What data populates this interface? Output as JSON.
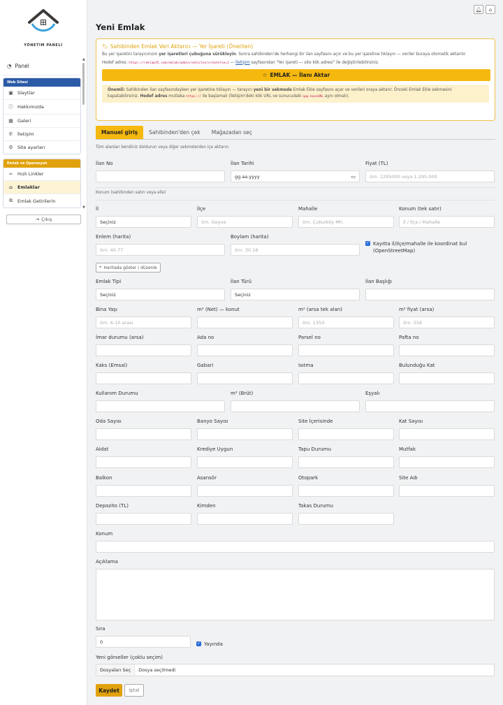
{
  "sidebar": {
    "brand": "YÖNETİM PANELİ",
    "panel": "Panel",
    "group1_title": "Web Sitesi",
    "group1_items": [
      "Slaytlar",
      "Hakkımızda",
      "Galeri",
      "İletişim",
      "Site ayarları"
    ],
    "group2_title": "Emlak ve Operasyon",
    "group2_items": [
      "Hızlı Linkler",
      "Emlaklar",
      "Emlak Getirilerin"
    ],
    "logout": "Çıkış"
  },
  "page_title": "Yeni Emlak",
  "importer": {
    "title": "Sahibinden Emlak Veri Aktarıcı — Yer İşareti (Önerilen)",
    "p1_a": "Bu yer işaretini tarayıcınızın ",
    "p1_b": "yer işaretleri çubuğuna sürükleyin",
    "p1_c": ". Sonra sahibinden'de herhangi bir ilan sayfasını açın ve bu yer işaretine tıklayın — veriler buraya otomatik aktarılır.",
    "p2_a": "Hedef adres: ",
    "p2_url": "https://reklam35.com/emlak/admin/vehicles/create?se=1",
    "p2_b": " — ",
    "p2_link": "İletişim",
    "p2_c": " sayfasından \"Yer işareti — site kök adresi\" ile değiştirilebilirsiniz.",
    "button": "EMLAK — İlanı Aktar",
    "note_a": "Önemli:",
    "note_b": " Sahibinden ilan sayfasındayken yer işaretine tıklayın — tarayıcı ",
    "note_c": "yeni bir sekmede",
    "note_d": " Emlak Ekle sayfasını açar ve verileri oraya aktarır. Önceki Emlak Ekle sekmesini kapatabilirsiniz. ",
    "note_e": "Hedef adres",
    "note_f": " mutlaka ",
    "note_code1": "https://",
    "note_g": " ile başlamalı (İletişim'deki kök URL ve sunucudaki ",
    "note_code2": "app.baseURL",
    "note_h": " aynı olmalı)."
  },
  "tabs": [
    "Manuel giriş",
    "Sahibinden'den çek",
    "Mağazadan seç"
  ],
  "tab_hint": "Tüm alanları kendiniz doldurun veya diğer sekmelerden içe aktarın.",
  "section_hint": "Konum (sahibinden satırı veya elle)",
  "fields": {
    "ilan_no": {
      "label": "İlan No",
      "value": ""
    },
    "ilan_tarihi": {
      "label": "İlan Tarihi",
      "value": "gg.aa.yyyy"
    },
    "fiyat": {
      "label": "Fiyat (TL)",
      "placeholder": "örn. 1295000 veya 1.295.000"
    },
    "il": {
      "label": "İl",
      "value": "Seçiniz"
    },
    "ilce": {
      "label": "İlçe",
      "placeholder": "örn. Geyve"
    },
    "mahalle": {
      "label": "Mahalle",
      "placeholder": "örn. Çukurköy Mh."
    },
    "konum_tek": {
      "label": "Konum (tek satır)",
      "placeholder": "İl / İlçe / Mahalle"
    },
    "enlem": {
      "label": "Enlem (harita)",
      "placeholder": "örn. 40.77"
    },
    "boylam": {
      "label": "Boylam (harita)",
      "placeholder": "örn. 30.18"
    },
    "emlak_tipi": {
      "label": "Emlak Tipi",
      "value": "Seçiniz"
    },
    "ilan_turu": {
      "label": "İlan Türü",
      "value": "Seçiniz"
    },
    "ilan_basligi": {
      "label": "İlan Başlığı",
      "value": ""
    },
    "bina_yasi": {
      "label": "Bina Yaşı",
      "placeholder": "örn. 6-10 arası"
    },
    "m2_net": {
      "label": "m² (Net) — konut",
      "value": ""
    },
    "m2_arsa": {
      "label": "m² (arsa tek alan)",
      "placeholder": "örn. 1350"
    },
    "m2_fiyat": {
      "label": "m² fiyat (arsa)",
      "placeholder": "örn. 556"
    },
    "imar": {
      "label": "İmar durumu (arsa)",
      "value": ""
    },
    "ada": {
      "label": "Ada no",
      "value": ""
    },
    "parsel": {
      "label": "Parsel no",
      "value": ""
    },
    "pafta": {
      "label": "Pafta no",
      "value": ""
    },
    "kaks": {
      "label": "Kaks (Emsal)",
      "value": ""
    },
    "gabari": {
      "label": "Gabari",
      "value": ""
    },
    "isitma": {
      "label": "Isıtma",
      "value": ""
    },
    "bulundugu_kat": {
      "label": "Bulunduğu Kat",
      "value": ""
    },
    "kullanim": {
      "label": "Kullanım Durumu",
      "value": ""
    },
    "m2_brut": {
      "label": "m² (Brüt)",
      "value": ""
    },
    "esyali": {
      "label": "Eşyalı",
      "value": ""
    },
    "oda": {
      "label": "Oda Sayısı",
      "value": ""
    },
    "banyo": {
      "label": "Banyo Sayısı",
      "value": ""
    },
    "site_icerisinde": {
      "label": "Site İçerisinde",
      "value": ""
    },
    "kat_sayisi": {
      "label": "Kat Sayısı",
      "value": ""
    },
    "aidat": {
      "label": "Aidat",
      "value": ""
    },
    "kredi": {
      "label": "Krediye Uygun",
      "value": ""
    },
    "tapu": {
      "label": "Tapu Durumu",
      "value": ""
    },
    "mutfak": {
      "label": "Mutfak",
      "value": ""
    },
    "balkon": {
      "label": "Balkon",
      "value": ""
    },
    "asansor": {
      "label": "Asansör",
      "value": ""
    },
    "otopark": {
      "label": "Otopark",
      "value": ""
    },
    "site_adi": {
      "label": "Site Adı",
      "value": ""
    },
    "depozito": {
      "label": "Depozito (TL)",
      "value": ""
    },
    "kimden": {
      "label": "Kimden",
      "value": ""
    },
    "takas": {
      "label": "Takas Durumu",
      "value": ""
    },
    "konum": {
      "label": "Konum",
      "value": ""
    },
    "aciklama": {
      "label": "Açıklama",
      "value": ""
    },
    "sira": {
      "label": "Sıra",
      "value": "0"
    }
  },
  "geo_checkbox": "Kayıtta il/ilçe/mahalle ile koordinat bul (OpenStreetMap)",
  "map_button": "Haritada göster / düzenle",
  "yayinda": "Yayında",
  "images_label": "Yeni görseller (çoklu seçim)",
  "file_button": "Dosyaları Seç",
  "file_text": "Dosya seçilmedi",
  "save": "Kaydet",
  "cancel": "İptal"
}
